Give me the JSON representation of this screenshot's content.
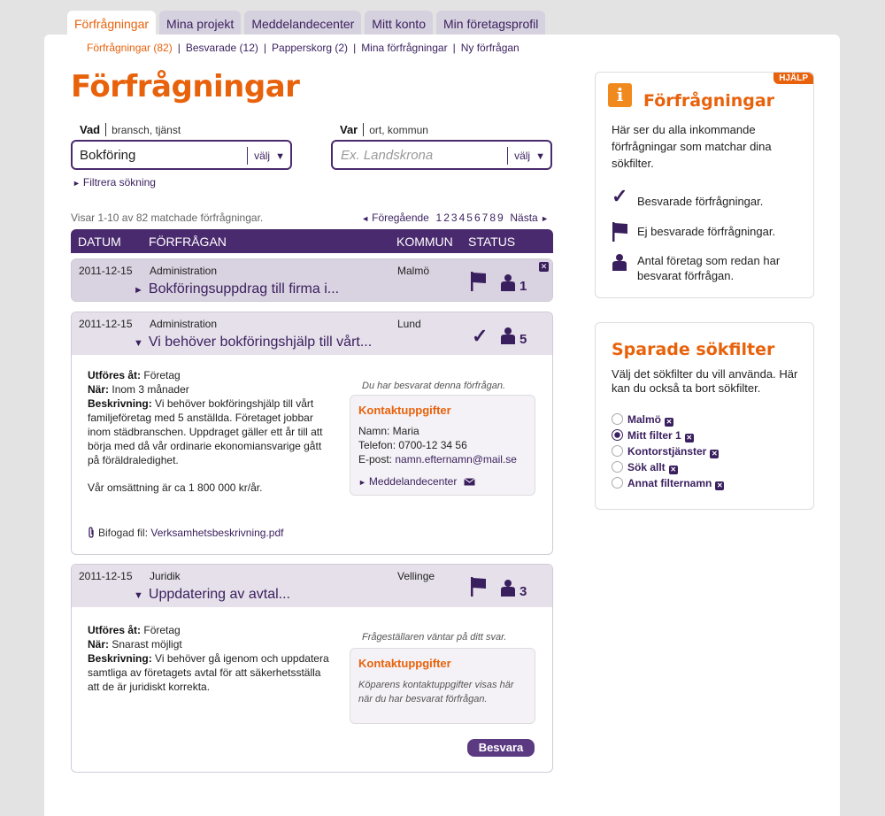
{
  "tabs": [
    "Förfrågningar",
    "Mina projekt",
    "Meddelandecenter",
    "Mitt konto",
    "Min företagsprofil"
  ],
  "subnav": [
    "Förfrågningar (82)",
    "Besvarade (12)",
    "Papperskorg (2)",
    "Mina förfrågningar",
    "Ny förfrågan"
  ],
  "page_title": "Förfrågningar",
  "search": {
    "vad_label": "Vad",
    "vad_hint": "bransch, tjänst",
    "vad_value": "Bokföring",
    "var_label": "Var",
    "var_hint": "ort, kommun",
    "var_placeholder": "Ex. Landskrona",
    "valj": "välj",
    "filter_link": "Filtrera sökning"
  },
  "results": {
    "showing": "Visar 1-10 av 82 matchade förfrågningar.",
    "prev": "Föregående",
    "next": "Nästa",
    "pages": [
      "1",
      "2",
      "3",
      "4",
      "5",
      "6",
      "7",
      "8",
      "9"
    ]
  },
  "table_headers": {
    "datum": "DATUM",
    "forfragan": "FÖRFRÅGAN",
    "kommun": "KOMMUN",
    "status": "STATUS"
  },
  "requests": [
    {
      "date": "2011-12-15",
      "category": "Administration",
      "title": "Bokföringsuppdrag till firma i...",
      "kommun": "Malmö",
      "count": "1"
    },
    {
      "date": "2011-12-15",
      "category": "Administration",
      "title": "Vi behöver bokföringshjälp till vårt...",
      "kommun": "Lund",
      "count": "5",
      "utfores_label": "Utföres åt:",
      "utfores": "Företag",
      "nar_label": "När:",
      "nar": "Inom 3 månader",
      "beskrivning_label": "Beskrivning:",
      "beskrivning": "Vi behöver bokföringshjälp till vårt familjeföretag med 5 anställda. Företaget jobbar inom städbranschen. Uppdraget gäller ett år till att börja med då vår ordinarie ekonomiansvarige gått på föräldraledighet.",
      "extra": "Vår omsättning är ca 1 800 000 kr/år.",
      "status_note": "Du har besvarat denna förfrågan.",
      "kontakt_title": "Kontaktuppgifter",
      "namn": "Namn: Maria",
      "telefon": "Telefon: 0700-12 34 56",
      "epost_label": "E-post:",
      "epost": "namn.efternamn@mail.se",
      "meddelande": "Meddelandecenter",
      "bifogad_label": "Bifogad fil:",
      "bifogad": "Verksamhetsbeskrivning.pdf"
    },
    {
      "date": "2011-12-15",
      "category": "Juridik",
      "title": "Uppdatering av avtal...",
      "kommun": "Vellinge",
      "count": "3",
      "utfores_label": "Utföres åt:",
      "utfores": "Företag",
      "nar_label": "När:",
      "nar": "Snarast möjligt",
      "beskrivning_label": "Beskrivning:",
      "beskrivning": "Vi behöver gå igenom och uppdatera samtliga av företagets avtal för att säkerhetsställa att de är juridiskt korrekta.",
      "status_note": "Frågeställaren väntar på ditt svar.",
      "kontakt_title": "Kontaktuppgifter",
      "kontakt_text": "Köparens kontaktuppgifter visas här när du har besvarat förfrågan.",
      "besvara": "Besvara"
    }
  ],
  "help": {
    "badge": "HJÄLP",
    "title": "Förfrågningar",
    "text": "Här ser du alla inkommande förfrågningar som matchar dina sökfilter.",
    "legend_answered": "Besvarade förfrågningar.",
    "legend_unanswered": "Ej besvarade förfrågningar.",
    "legend_count": "Antal företag som redan har besvarat förfrågan."
  },
  "saved_filters": {
    "title": "Sparade sökfilter",
    "text": "Välj det sökfilter du vill använda. Här kan du också ta bort sökfilter.",
    "items": [
      "Malmö",
      "Mitt filter 1",
      "Kontorstjänster",
      "Sök allt",
      "Annat filternamn"
    ],
    "selected": "Mitt filter 1"
  },
  "colors": {
    "accent": "#e8620c",
    "brand": "#4a2a6e",
    "header_bg": "#d9d2e0"
  }
}
